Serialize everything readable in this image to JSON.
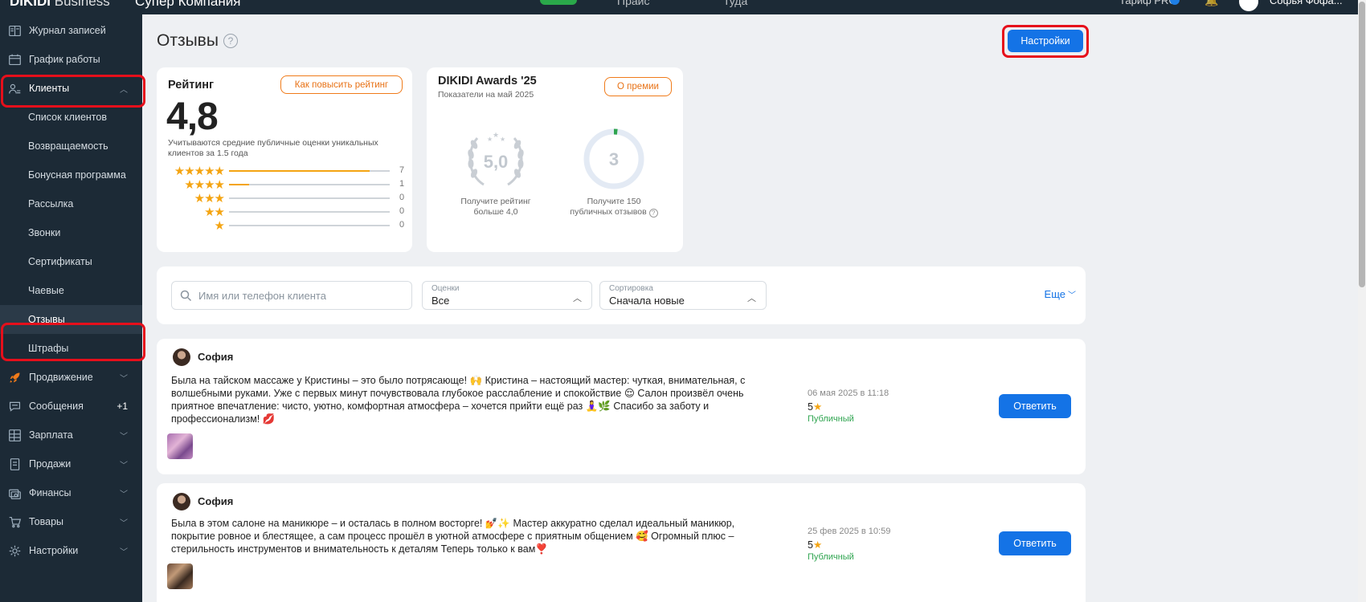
{
  "topbar": {
    "brand": "DIKIDI",
    "brand_suffix": "Business",
    "company": "Супер Компания",
    "nav1": "Прайс",
    "nav2": "Туда",
    "tariff": "Тариф PRO",
    "user": "Софья Фофа..."
  },
  "sidebar": {
    "items": [
      {
        "label": "Журнал записей",
        "icon": "journal-icon"
      },
      {
        "label": "График работы",
        "icon": "calendar-icon"
      },
      {
        "label": "Клиенты",
        "icon": "clients-icon"
      },
      {
        "label": "Список клиентов"
      },
      {
        "label": "Возвращаемость"
      },
      {
        "label": "Бонусная программа"
      },
      {
        "label": "Рассылка"
      },
      {
        "label": "Звонки"
      },
      {
        "label": "Сертификаты"
      },
      {
        "label": "Чаевые"
      },
      {
        "label": "Отзывы"
      },
      {
        "label": "Штрафы"
      },
      {
        "label": "Продвижение",
        "icon": "rocket-icon"
      },
      {
        "label": "Сообщения",
        "icon": "chat-icon",
        "badge": "+1"
      },
      {
        "label": "Зарплата",
        "icon": "grid-icon"
      },
      {
        "label": "Продажи",
        "icon": "receipt-icon"
      },
      {
        "label": "Финансы",
        "icon": "money-icon"
      },
      {
        "label": "Товары",
        "icon": "cart-icon"
      },
      {
        "label": "Настройки",
        "icon": "gear-icon"
      }
    ]
  },
  "page": {
    "title": "Отзывы",
    "help": "?",
    "settings_button": "Настройки"
  },
  "rating": {
    "title": "Рейтинг",
    "improve_button": "Как повысить рейтинг",
    "value": "4,8",
    "note": "Учитываются средние публичные оценки уникальных клиентов за 1.5 года",
    "distribution": [
      {
        "stars": 5,
        "count": 7,
        "fraction": 0.875
      },
      {
        "stars": 4,
        "count": 1,
        "fraction": 0.125
      },
      {
        "stars": 3,
        "count": 0,
        "fraction": 0
      },
      {
        "stars": 2,
        "count": 0,
        "fraction": 0
      },
      {
        "stars": 1,
        "count": 0,
        "fraction": 0
      }
    ]
  },
  "awards": {
    "title": "DIKIDI Awards '25",
    "subtitle": "Показатели на май 2025",
    "about_button": "О премии",
    "laurel_value": "5,0",
    "laurel_caption_1": "Получите рейтинг",
    "laurel_caption_2": "больше 4,0",
    "ring_value": "3",
    "ring_progress": 0.02,
    "ring_caption_1": "Получите 150",
    "ring_caption_2": "публичных отзывов"
  },
  "filters": {
    "search_placeholder": "Имя или телефон клиента",
    "rating_label": "Оценки",
    "rating_value": "Все",
    "sort_label": "Сортировка",
    "sort_value": "Сначала новые",
    "more": "Еще"
  },
  "reviews": [
    {
      "name": "София",
      "text": "Была на тайском массаже у Кристины – это было потрясающе! 🙌 Кристина – настоящий мастер: чуткая, внимательная, с волшебными руками. Уже с первых минут почувствовала глубокое расслабление и спокойствие 😌 Салон произвёл очень приятное впечатление: чисто, уютно, комфортная атмосфера – хочется прийти ещё раз 🧘‍♀️🌿 Спасибо за заботу и профессионализм! 💋",
      "date": "06 мая 2025 в 11:18",
      "score": "5",
      "visibility": "Публичный",
      "reply_button": "Ответить"
    },
    {
      "name": "София",
      "text": "Была в этом салоне на маникюре – и осталась в полном восторге! 💅✨ Мастер аккуратно сделал идеальный маникюр, покрытие ровное и блестящее, а сам процесс прошёл в уютной атмосфере с приятным общением 🥰 Огромный плюс – стерильность инструментов и внимательность к деталям Теперь только к вам❣️",
      "date": "25 фев 2025 в 10:59",
      "score": "5",
      "visibility": "Публичный",
      "reply_button": "Ответить"
    }
  ],
  "colors": {
    "sidebar_bg": "#1c2a36",
    "accent": "#1473e6",
    "highlight": "#e60f1b",
    "star": "#f4a412",
    "public": "#2ea44f"
  }
}
